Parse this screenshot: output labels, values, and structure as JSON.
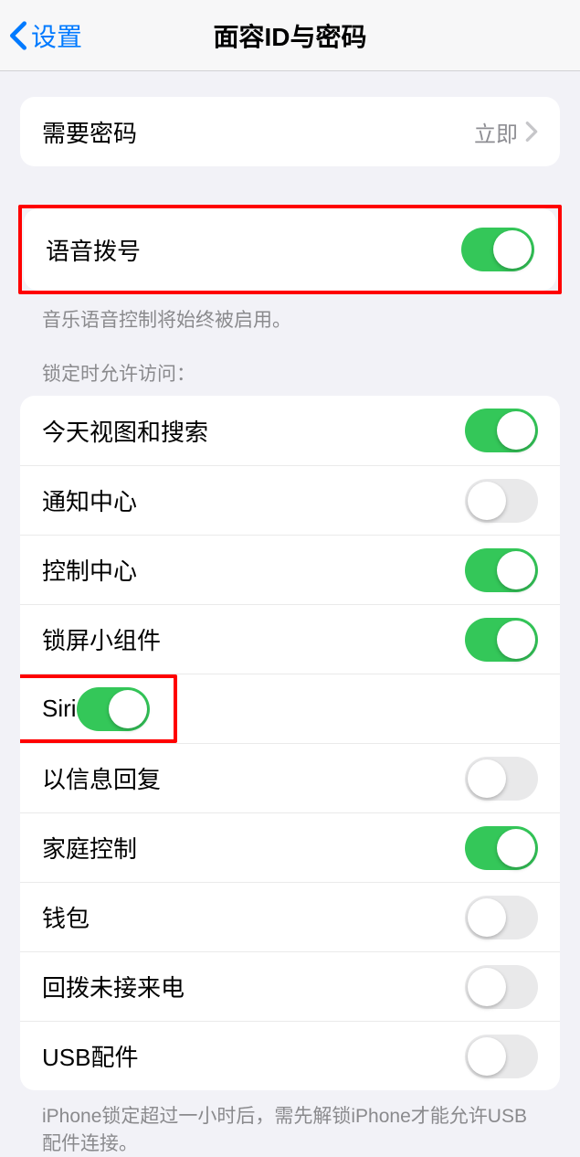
{
  "nav": {
    "back": "设置",
    "title": "面容ID与密码"
  },
  "passcode_row": {
    "label": "需要密码",
    "value": "立即"
  },
  "voice_row": {
    "label": "语音拨号",
    "on": true
  },
  "voice_footer": "音乐语音控制将始终被启用。",
  "lock_header": "锁定时允许访问：",
  "lock_rows": [
    {
      "label": "今天视图和搜索",
      "on": true
    },
    {
      "label": "通知中心",
      "on": false
    },
    {
      "label": "控制中心",
      "on": true
    },
    {
      "label": "锁屏小组件",
      "on": true
    },
    {
      "label": "Siri",
      "on": true
    },
    {
      "label": "以信息回复",
      "on": false
    },
    {
      "label": "家庭控制",
      "on": true
    },
    {
      "label": "钱包",
      "on": false
    },
    {
      "label": "回拨未接来电",
      "on": false
    },
    {
      "label": "USB配件",
      "on": false
    }
  ],
  "lock_footer": "iPhone锁定超过一小时后，需先解锁iPhone才能允许USB配件连接。"
}
